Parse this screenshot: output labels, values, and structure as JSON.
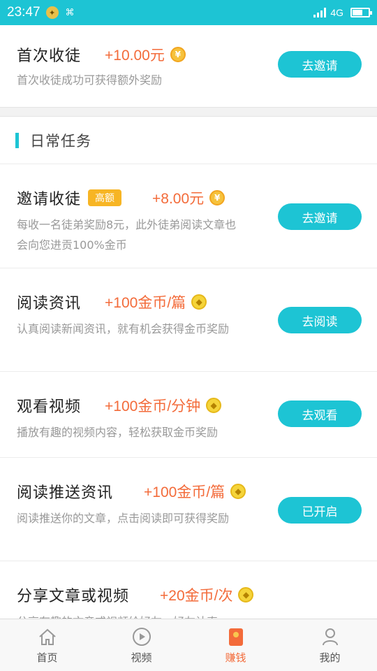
{
  "status": {
    "time": "23:47",
    "network": "4G",
    "battery_level": 0.6
  },
  "top_task": {
    "title": "首次收徒",
    "reward": "+10.00元",
    "desc": "首次收徒成功可获得额外奖励",
    "button": "去邀请",
    "coin_icon": "yuan-coin-icon"
  },
  "section": {
    "title": "日常任务"
  },
  "tasks": [
    {
      "title": "邀请收徒",
      "tag": "高额",
      "reward": "+8.00元",
      "desc": "每收一名徒弟奖励8元，此外徒弟阅读文章也会向您进贡100%金币",
      "button": "去邀请"
    },
    {
      "title": "阅读资讯",
      "reward": "+100金币/篇",
      "desc": "认真阅读新闻资讯，就有机会获得金币奖励",
      "button": "去阅读"
    },
    {
      "title": "观看视频",
      "reward": "+100金币/分钟",
      "desc": "播放有趣的视频内容，轻松获取金币奖励",
      "button": "去观看"
    },
    {
      "title": "阅读推送资讯",
      "reward": "+100金币/篇",
      "desc": "阅读推送你的文章，点击阅读即可获得奖励",
      "button": "已开启"
    },
    {
      "title": "分享文章或视频",
      "reward": "+20金币/次",
      "desc": "分享有趣的文章或视频给好友，好友认真"
    }
  ],
  "nav": {
    "home": "首页",
    "video": "视频",
    "earn": "赚钱",
    "mine": "我的"
  },
  "colors": {
    "accent": "#1dc4d4",
    "reward": "#f36b3a",
    "tag": "#f7b524"
  }
}
